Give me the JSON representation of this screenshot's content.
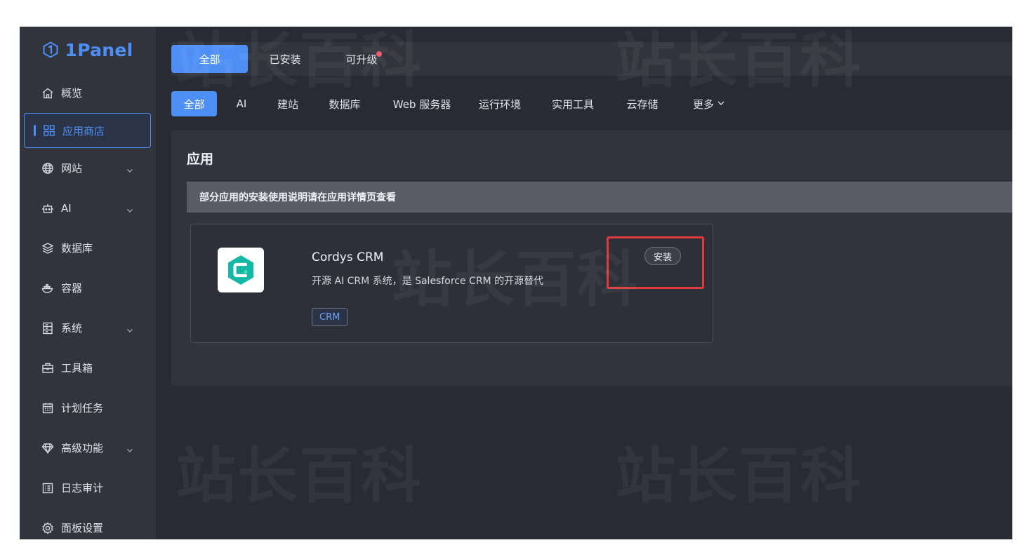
{
  "brand": {
    "name": "1Panel",
    "color": "#4e8ff5"
  },
  "sidebar": {
    "items": [
      {
        "label": "概览",
        "icon": "home-icon"
      },
      {
        "label": "应用商店",
        "icon": "grid-icon",
        "active": true
      },
      {
        "label": "网站",
        "icon": "globe-icon",
        "expandable": true
      },
      {
        "label": "AI",
        "icon": "robot-icon",
        "expandable": true
      },
      {
        "label": "数据库",
        "icon": "layers-icon"
      },
      {
        "label": "容器",
        "icon": "docker-icon"
      },
      {
        "label": "系统",
        "icon": "server-icon",
        "expandable": true
      },
      {
        "label": "工具箱",
        "icon": "toolbox-icon"
      },
      {
        "label": "计划任务",
        "icon": "calendar-icon"
      },
      {
        "label": "高级功能",
        "icon": "diamond-icon",
        "expandable": true
      },
      {
        "label": "日志审计",
        "icon": "log-icon"
      },
      {
        "label": "面板设置",
        "icon": "settings-icon"
      }
    ]
  },
  "top_tabs": [
    {
      "label": "全部",
      "active": true
    },
    {
      "label": "已安装"
    },
    {
      "label": "可升级",
      "badge": true
    }
  ],
  "categories": [
    {
      "label": "全部",
      "active": true
    },
    {
      "label": "AI"
    },
    {
      "label": "建站"
    },
    {
      "label": "数据库"
    },
    {
      "label": "Web 服务器"
    },
    {
      "label": "运行环境"
    },
    {
      "label": "实用工具"
    },
    {
      "label": "云存储"
    },
    {
      "label": "更多"
    }
  ],
  "panel": {
    "title": "应用",
    "notice": "部分应用的安装使用说明请在应用详情页查看"
  },
  "app_card": {
    "name": "Cordys CRM",
    "description": "开源 AI CRM 系统，是 Salesforce CRM 的开源替代",
    "tag": "CRM",
    "install_label": "安装",
    "icon": "cordys-logo-icon"
  },
  "watermark": "站长百科",
  "colors": {
    "accent": "#4e8ff5",
    "highlight": "#e03a3a",
    "badge": "#f0556a",
    "app_logo": "#14b8a6"
  }
}
